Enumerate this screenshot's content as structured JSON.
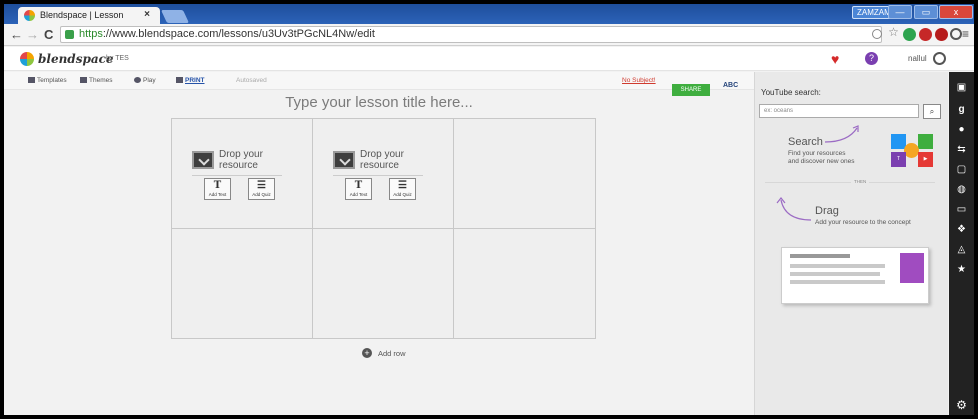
{
  "browser": {
    "tab_title": "Blendspace | Lesson",
    "tab_close": "×",
    "user_chip": "ZAMZAM",
    "window_buttons": [
      "—",
      "▭",
      "x"
    ],
    "url_https": "https",
    "url_rest": "://www.blendspace.com/lessons/u3Uv3tPGcNL4Nw/edit",
    "back": "←",
    "forward": "→",
    "reload": "C",
    "menu": "≡"
  },
  "app": {
    "logo": "blendspace",
    "logo_by": "by TES",
    "username": "nallul",
    "help": "?"
  },
  "toolbar": {
    "templates": "Templates",
    "themes": "Themes",
    "play": "Play",
    "print": "PRINT",
    "autosaved": "Autosaved",
    "no_subject": "No Subject!",
    "share": "SHARE",
    "abc": "ABC"
  },
  "canvas": {
    "title_placeholder": "Type your lesson title here...",
    "drop_line1": "Drop your",
    "drop_line2": "resource",
    "add_text_glyph": "T",
    "add_text": "Add Text",
    "add_quiz_glyph": "☰",
    "add_quiz": "Add Quiz",
    "add_row": "Add row"
  },
  "panel": {
    "youtube_label": "YouTube search:",
    "search_placeholder": "ex: oceans",
    "search_button": "🔍",
    "search_heading": "Search",
    "search_sub1": "Find your resources",
    "search_sub2": "and discover new ones",
    "then": "THEN",
    "drag_heading": "Drag",
    "drag_sub": "Add your resource to the concept"
  },
  "colors": {
    "share_green": "#3fae3f",
    "no_subject_red": "#d03a2e",
    "print_blue": "#2653a8"
  }
}
